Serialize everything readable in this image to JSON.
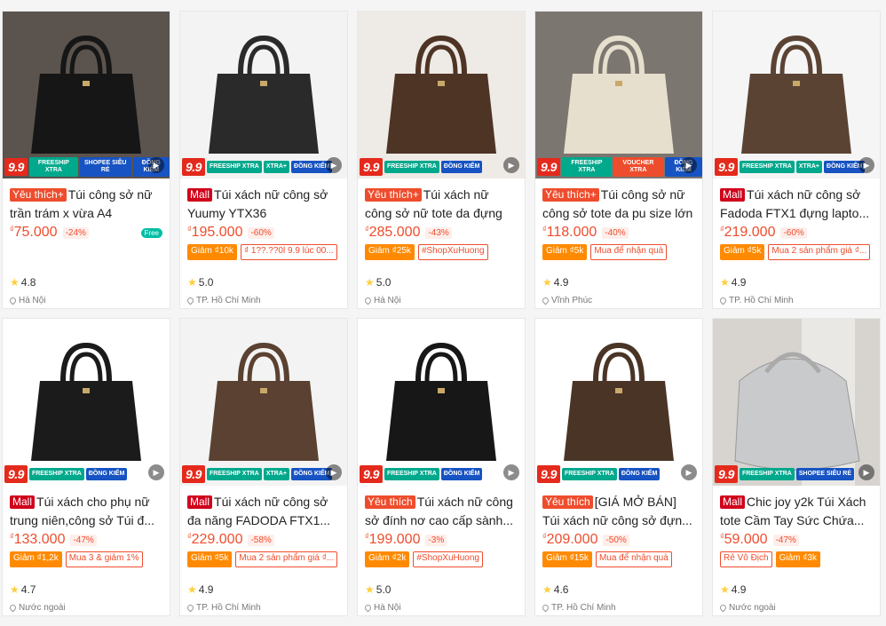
{
  "products": [
    {
      "tag": "Yêu thích+",
      "tag_type": "yt",
      "title": "Túi công sở nữ trần trám x vừa A4",
      "currency": "₫",
      "price": "75.000",
      "discount": "-24%",
      "promos": [],
      "free_badge": "Free",
      "rating": "4.8",
      "location": "Hà Nội",
      "badges": [
        "FREESHIP XTRA",
        "SHOPEE SIÊU RẺ",
        "ĐỒNG KIỂM"
      ],
      "bg": "#5b534d",
      "bag": "#161616"
    },
    {
      "tag": "Mall",
      "tag_type": "mall",
      "title": "Túi xách nữ công sở Yuumy YTX36",
      "currency": "₫",
      "price": "195.000",
      "discount": "-60%",
      "promos": [
        {
          "t": "Giảm ₫10k",
          "f": true
        },
        {
          "t": "₫ 1??.??0l 9.9 lúc 00...",
          "f": false
        }
      ],
      "rating": "5.0",
      "location": "TP. Hồ Chí Minh",
      "badges": [
        "FREESHIP XTRA",
        "XTRA+",
        "ĐỒNG KIỂM"
      ],
      "bg": "#f3f3f3",
      "bag": "#2a2a2a"
    },
    {
      "tag": "Yêu thích+",
      "tag_type": "yt",
      "title": "Túi xách nữ công sở nữ tote da đựng laptop...",
      "currency": "₫",
      "price": "285.000",
      "discount": "-43%",
      "promos": [
        {
          "t": "Giảm ₫25k",
          "f": true
        },
        {
          "t": "#ShopXuHuong",
          "f": false
        }
      ],
      "rating": "5.0",
      "location": "Hà Nội",
      "badges": [
        "FREESHIP XTRA",
        "ĐỒNG KIỂM"
      ],
      "bg": "#eeeae6",
      "bag": "#4e3425"
    },
    {
      "tag": "Yêu thích+",
      "tag_type": "yt",
      "title": "Túi công sở nữ công sở tote da pu size lớn để...",
      "currency": "₫",
      "price": "118.000",
      "discount": "-40%",
      "promos": [
        {
          "t": "Giảm ₫5k",
          "f": true
        },
        {
          "t": "Mua để nhận quà",
          "f": false
        }
      ],
      "rating": "4.9",
      "location": "Vĩnh Phúc",
      "badges": [
        "FREESHIP XTRA",
        "VOUCHER XTRA",
        "ĐỒNG KIỂM"
      ],
      "bg": "#7c7670",
      "bag": "#e7dfcd"
    },
    {
      "tag": "Mall",
      "tag_type": "mall",
      "title": "Túi xách nữ công sở Fadoda FTX1 đựng lapto...",
      "currency": "₫",
      "price": "219.000",
      "discount": "-60%",
      "promos": [
        {
          "t": "Giảm ₫5k",
          "f": true
        },
        {
          "t": "Mua 2 sản phẩm giá ₫...",
          "f": false
        }
      ],
      "rating": "4.9",
      "location": "TP. Hồ Chí Minh",
      "badges": [
        "FREESHIP XTRA",
        "XTRA+",
        "ĐỒNG KIỂM"
      ],
      "bg": "#f5f5f5",
      "bag": "#5b4334"
    },
    {
      "tag": "Mall",
      "tag_type": "mall",
      "title": "Túi xách cho phụ nữ trung niên,công sở Túi đ...",
      "currency": "₫",
      "price": "133.000",
      "discount": "-47%",
      "promos": [
        {
          "t": "Giảm ₫1,2k",
          "f": true
        },
        {
          "t": "Mua 3 & giảm 1%",
          "f": false
        }
      ],
      "rating": "4.7",
      "location": "Nước ngoài",
      "badges": [
        "FREESHIP XTRA",
        "ĐỒNG KIỂM"
      ],
      "bg": "#ffffff",
      "bag": "#1b1b1b"
    },
    {
      "tag": "Mall",
      "tag_type": "mall",
      "title": "Túi xách nữ công sở đa năng FADODA FTX1...",
      "currency": "₫",
      "price": "229.000",
      "discount": "-58%",
      "promos": [
        {
          "t": "Giảm ₫5k",
          "f": true
        },
        {
          "t": "Mua 2 sản phẩm giá ₫...",
          "f": false
        }
      ],
      "rating": "4.9",
      "location": "TP. Hồ Chí Minh",
      "badges": [
        "FREESHIP XTRA",
        "XTRA+",
        "ĐỒNG KIỂM"
      ],
      "bg": "#f3f3f3",
      "bag": "#5a4131"
    },
    {
      "tag": "Yêu thích",
      "tag_type": "yt",
      "title": "Túi xách nữ công sở đính nơ cao cấp sành...",
      "currency": "₫",
      "price": "199.000",
      "discount": "-3%",
      "promos": [
        {
          "t": "Giảm ₫2k",
          "f": true
        },
        {
          "t": "#ShopXuHuong",
          "f": false
        }
      ],
      "rating": "5.0",
      "location": "Hà Nội",
      "badges": [
        "FREESHIP XTRA",
        "ĐỒNG KIỂM"
      ],
      "bg": "#ffffff",
      "bag": "#171717"
    },
    {
      "tag": "Yêu thích",
      "tag_type": "yt",
      "title": "[GIÁ MỞ BÁN] Túi xách nữ công sở đựn...",
      "currency": "₫",
      "price": "209.000",
      "discount": "-50%",
      "promos": [
        {
          "t": "Giảm ₫15k",
          "f": true
        },
        {
          "t": "Mua để nhận quà",
          "f": false
        }
      ],
      "rating": "4.6",
      "location": "TP. Hồ Chí Minh",
      "badges": [
        "FREESHIP XTRA",
        "ĐỒNG KIỂM"
      ],
      "bg": "#ffffff",
      "bag": "#4a3426"
    },
    {
      "tag": "Mall",
      "tag_type": "mall",
      "title": "Chic joy y2k Túi Xách tote Cầm Tay Sức Chứa...",
      "currency": "₫",
      "price": "59.000",
      "discount": "-47%",
      "promos": [
        {
          "t": "Rẻ Vô Địch",
          "f": false
        },
        {
          "t": "Giảm ₫3k",
          "f": true
        }
      ],
      "rating": "4.9",
      "location": "Nước ngoài",
      "badges": [
        "FREESHIP XTRA",
        "SHOPEE SIÊU RẺ"
      ],
      "bg": "#d7d4cf",
      "bag": "#c9cacc"
    }
  ],
  "sale_badge": "9.9",
  "play_icon": "▶"
}
